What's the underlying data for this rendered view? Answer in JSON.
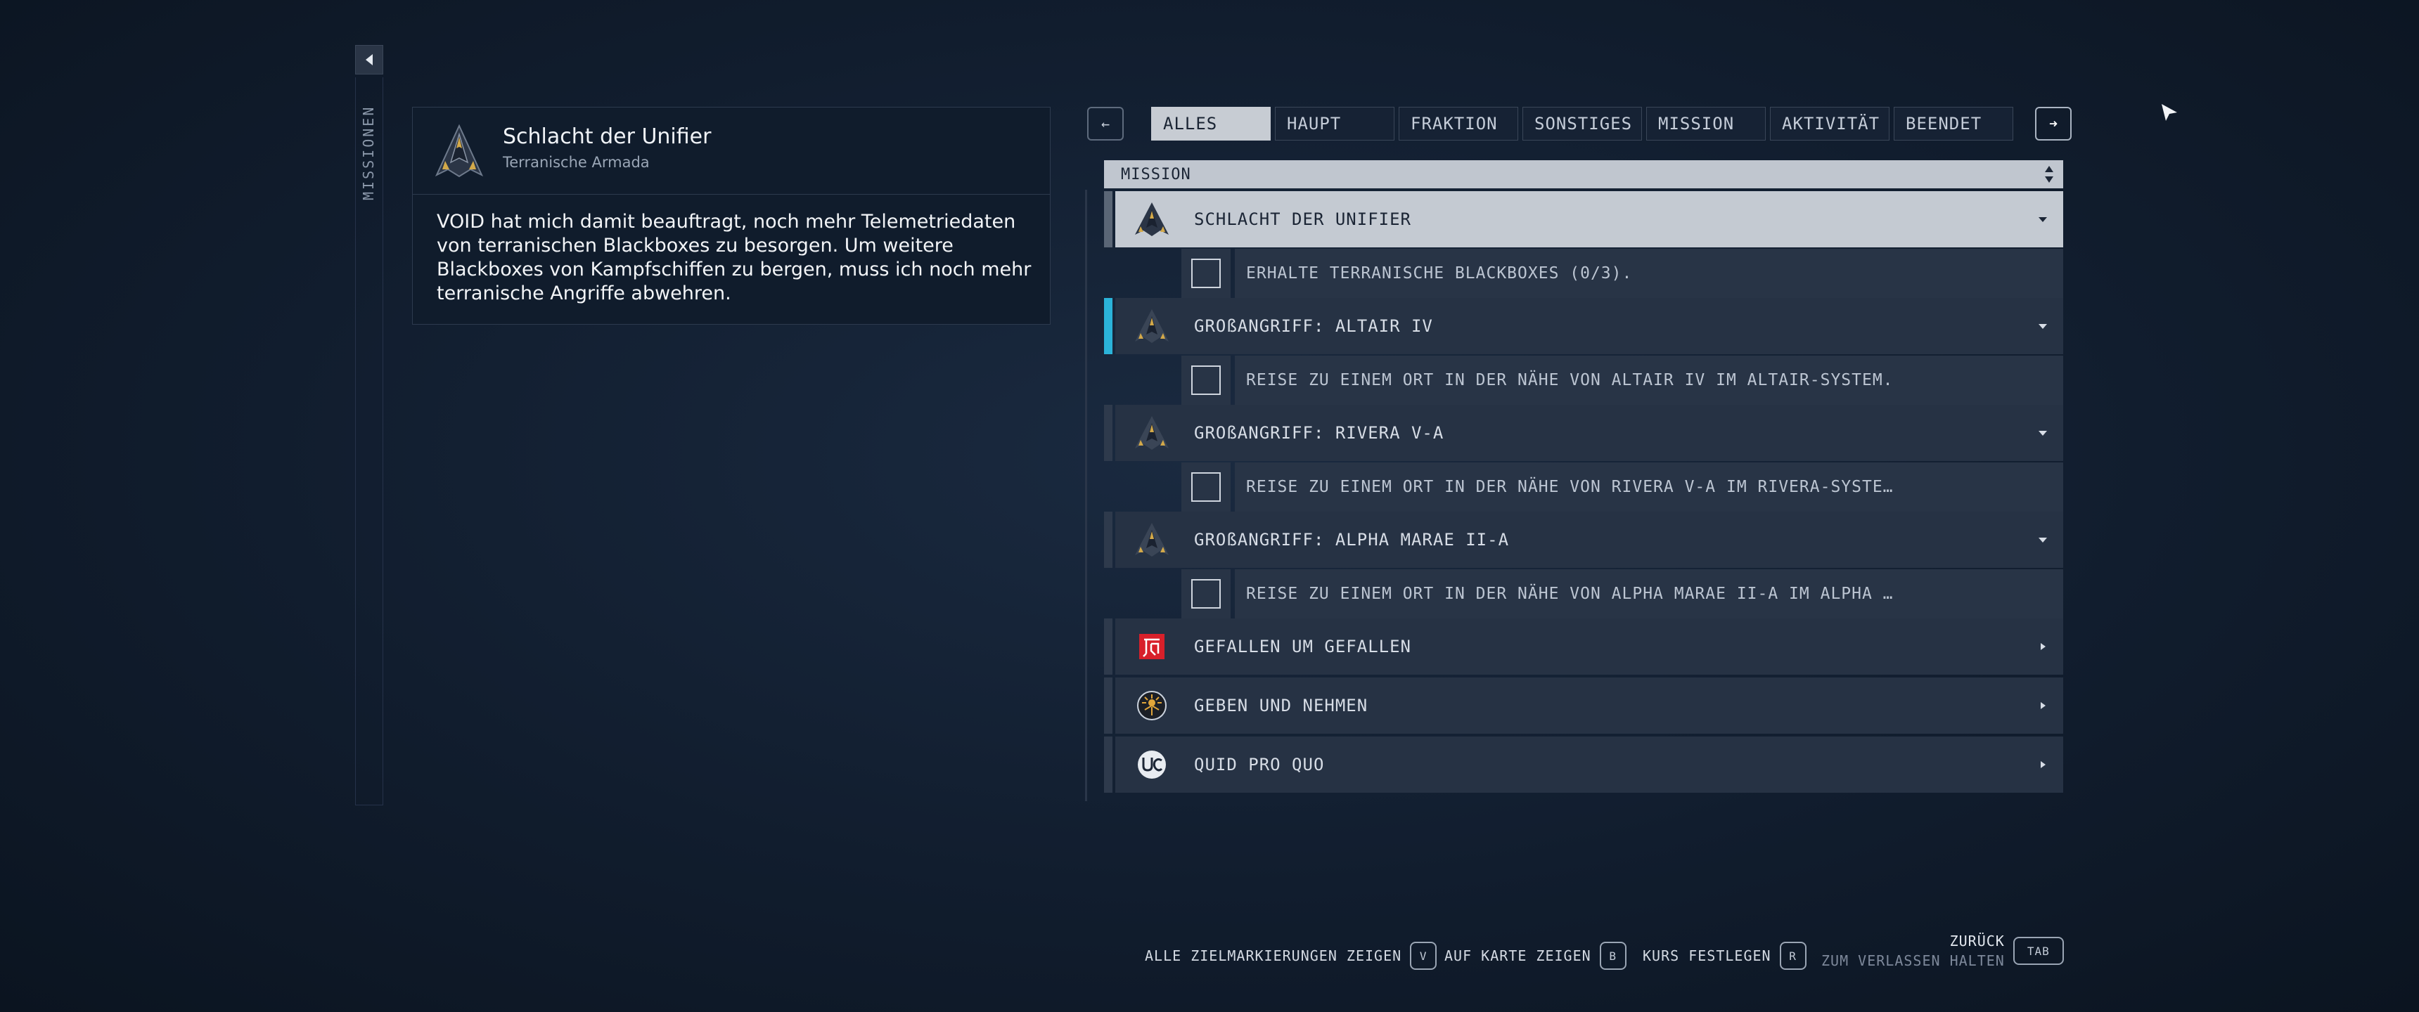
{
  "sidebar": {
    "label": "MISSIONEN"
  },
  "detail": {
    "title": "Schlacht der Unifier",
    "subtitle": "Terranische Armada",
    "description": "VOID hat mich damit beauftragt, noch mehr Telemetriedaten von terranischen Blackboxes zu besorgen. Um weitere Blackboxes von Kampfschiffen zu bergen, muss ich noch mehr terranische Angriffe abwehren."
  },
  "tabs": {
    "prev": "←",
    "next": "➜",
    "items": [
      {
        "label": "ALLES",
        "active": true
      },
      {
        "label": "HAUPT"
      },
      {
        "label": "FRAKTION"
      },
      {
        "label": "SONSTIGES"
      },
      {
        "label": "MISSION"
      },
      {
        "label": "AKTIVITÄT"
      },
      {
        "label": "BEENDET"
      }
    ]
  },
  "list": {
    "section_header": "MISSION",
    "missions": [
      {
        "name": "SCHLACHT DER UNIFIER",
        "icon": "armada-emblem-icon",
        "state": "selected",
        "objective": "ERHALTE TERRANISCHE BLACKBOXES (0/3)."
      },
      {
        "name": "GROßANGRIFF: ALTAIR IV",
        "icon": "armada-emblem-icon",
        "state": "tracked",
        "objective": "REISE ZU EINEM ORT IN DER NÄHE VON ALTAIR IV IM ALTAIR-SYSTEM."
      },
      {
        "name": "GROßANGRIFF: RIVERA V-A",
        "icon": "armada-emblem-icon",
        "state": "expanded",
        "objective": "REISE ZU EINEM ORT IN DER NÄHE VON RIVERA V-A IM RIVERA-SYSTE…"
      },
      {
        "name": "GROßANGRIFF: ALPHA MARAE II-A",
        "icon": "armada-emblem-icon",
        "state": "expanded",
        "objective": "REISE ZU EINEM ORT IN DER NÄHE VON ALPHA MARAE II-A IM ALPHA …"
      },
      {
        "name": "GEFALLEN UM GEFALLEN",
        "icon": "red-faction-icon",
        "state": "collapsed"
      },
      {
        "name": "GEBEN UND NEHMEN",
        "icon": "sun-faction-icon",
        "state": "collapsed"
      },
      {
        "name": "QUID PRO QUO",
        "icon": "uc-faction-icon",
        "state": "collapsed"
      }
    ]
  },
  "hints": {
    "markers": {
      "label": "ALLE ZIELMARKIERUNGEN ZEIGEN",
      "key": "V"
    },
    "map": {
      "label": "AUF KARTE ZEIGEN",
      "key": "B"
    },
    "course": {
      "label": "KURS FESTLEGEN",
      "key": "R"
    },
    "back": {
      "title": "ZURÜCK",
      "subtitle": "ZUM VERLASSEN HALTEN",
      "key": "TAB"
    }
  },
  "colors": {
    "tracked_accent": "#2bb3d9",
    "selected_row": "#c4cad2",
    "row_bg": "#263244"
  }
}
